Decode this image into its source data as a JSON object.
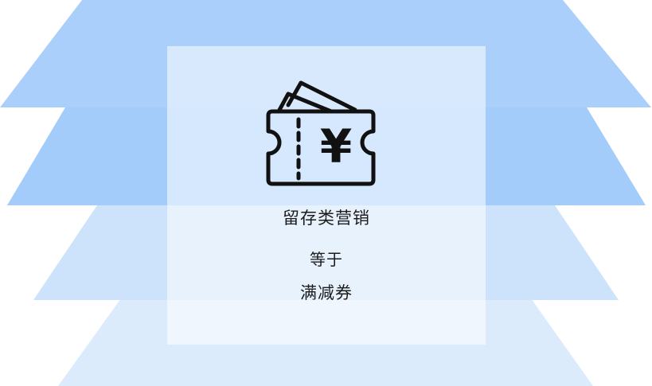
{
  "diagram": {
    "category_label": "留存类营销",
    "relation_label": "等于",
    "example_label": "满减券",
    "icon": "ticket-yuan-icon",
    "currency_symbol": "¥"
  },
  "colors": {
    "layer_top": "#aacffa",
    "layer_second": "#a3ccfa",
    "layer_third": "#cde2fb",
    "layer_bottom": "#dcebfc",
    "card": "#ffffff",
    "icon_stroke": "#111111",
    "text": "#1c1c1c"
  }
}
